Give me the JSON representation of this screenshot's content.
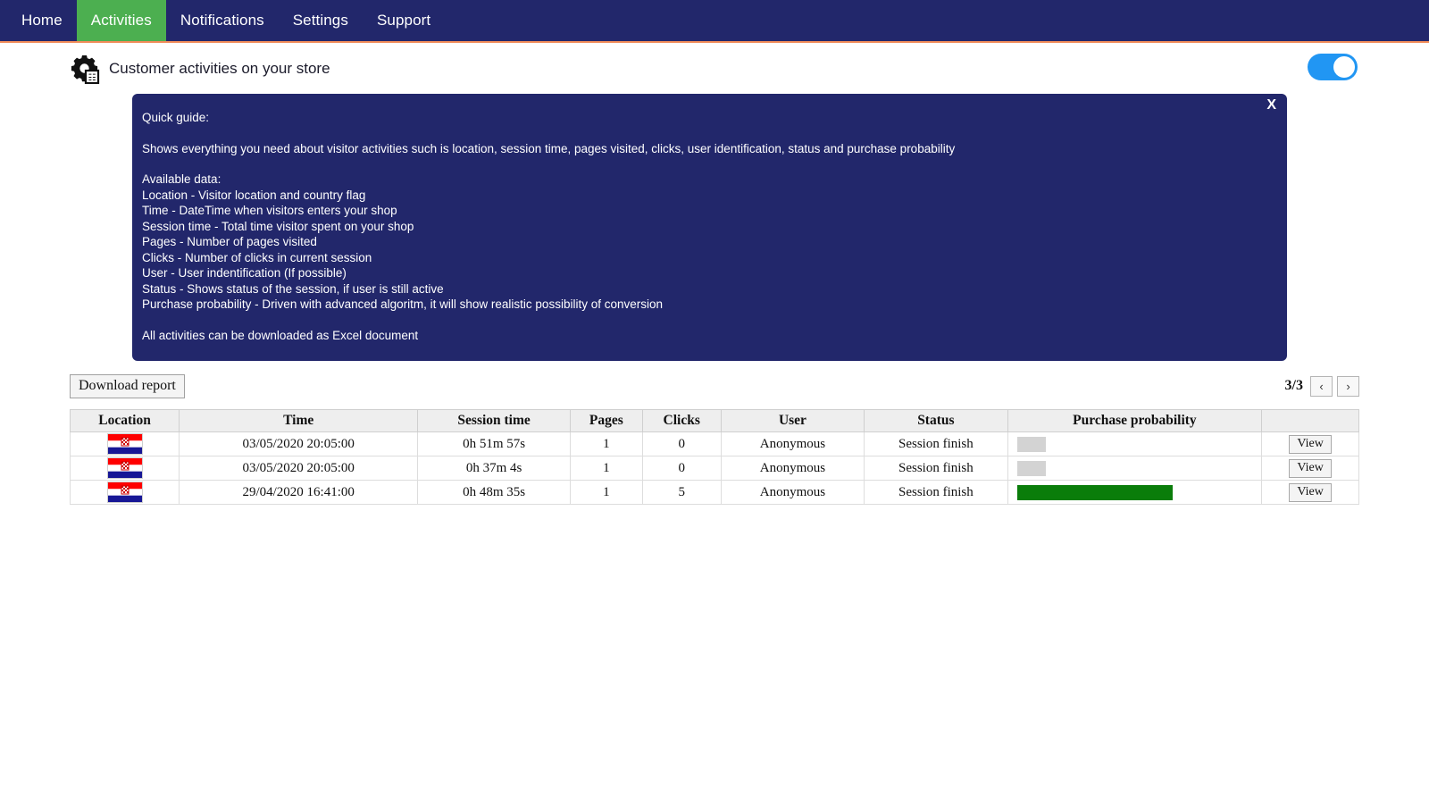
{
  "nav": {
    "items": [
      {
        "label": "Home",
        "active": false
      },
      {
        "label": "Activities",
        "active": true
      },
      {
        "label": "Notifications",
        "active": false
      },
      {
        "label": "Settings",
        "active": false
      },
      {
        "label": "Support",
        "active": false
      }
    ],
    "bg_color": "#22276b",
    "active_color": "#4caf50",
    "underline_color": "#f08c5a"
  },
  "header": {
    "title": "Customer activities on your store",
    "icon": "gear-document-icon",
    "toggle_state": "on",
    "toggle_color": "#2196f3"
  },
  "guide": {
    "close_label": "X",
    "lines": [
      "Quick guide:",
      "",
      "Shows everything you need about visitor activities such is location, session time, pages visited, clicks, user identification, status and purchase probability",
      "",
      "Available data:",
      "Location - Visitor location and country flag",
      "Time - DateTime when visitors enters your shop",
      "Session time - Total time visitor spent on your shop",
      "Pages - Number of pages visited",
      "Clicks - Number of clicks in current session",
      "User - User indentification (If possible)",
      "Status - Shows status of the session, if user is still active",
      "Purchase probability - Driven with advanced algoritm, it will show realistic possibility of conversion",
      "",
      "All activities can be downloaded as Excel document"
    ],
    "bg_color": "#22276b"
  },
  "toolbar": {
    "download_label": "Download report",
    "page_indicator": "3/3",
    "prev_label": "‹",
    "next_label": "›"
  },
  "table": {
    "columns": [
      "Location",
      "Time",
      "Session time",
      "Pages",
      "Clicks",
      "User",
      "Status",
      "Purchase probability",
      ""
    ],
    "rows": [
      {
        "location_flag": "croatia-flag",
        "time": "03/05/2020 20:05:00",
        "session_time": "0h 51m 57s",
        "pages": "1",
        "clicks": "0",
        "user": "Anonymous",
        "status": "Session finish",
        "probability_percent": 12,
        "probability_level": "low",
        "action_label": "View"
      },
      {
        "location_flag": "croatia-flag",
        "time": "03/05/2020 20:05:00",
        "session_time": "0h 37m 4s",
        "pages": "1",
        "clicks": "0",
        "user": "Anonymous",
        "status": "Session finish",
        "probability_percent": 12,
        "probability_level": "low",
        "action_label": "View"
      },
      {
        "location_flag": "croatia-flag",
        "time": "29/04/2020 16:41:00",
        "session_time": "0h 48m 35s",
        "pages": "1",
        "clicks": "5",
        "user": "Anonymous",
        "status": "Session finish",
        "probability_percent": 64,
        "probability_level": "high",
        "action_label": "View"
      }
    ],
    "bar_colors": {
      "low": "#d3d3d3",
      "high": "#0a7d0a"
    }
  }
}
